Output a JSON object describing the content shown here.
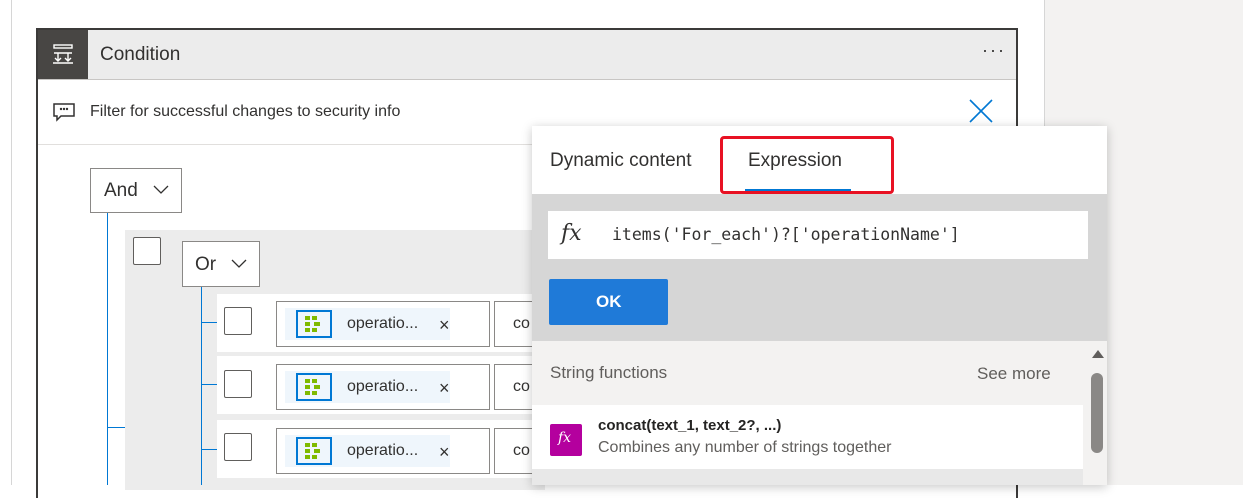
{
  "condition": {
    "title": "Condition",
    "more_label": "···",
    "comment": "Filter for successful changes to security info"
  },
  "builder": {
    "and_label": "And",
    "or_label": "Or",
    "rows": [
      {
        "token_label": "operatio...",
        "remove_label": "×",
        "operator_partial": "co"
      },
      {
        "token_label": "operatio...",
        "remove_label": "×",
        "operator_partial": "co"
      },
      {
        "token_label": "operatio...",
        "remove_label": "×",
        "operator_partial": "co"
      }
    ]
  },
  "popup": {
    "tabs": [
      {
        "label": "Dynamic content",
        "active": false
      },
      {
        "label": "Expression",
        "active": true
      }
    ],
    "expression_icon": "fx",
    "expression_value": "items('For_each')?['operationName']",
    "ok_label": "OK",
    "functions": {
      "section_title": "String functions",
      "see_more_label": "See more",
      "items": [
        {
          "icon": "fx",
          "name": "concat(text_1, text_2?, ...)",
          "description": "Combines any number of strings together"
        }
      ]
    }
  },
  "colors": {
    "accent": "#0078d4",
    "ok_button": "#1f7ad8",
    "highlight": "#e81123",
    "function_icon": "#b4009e"
  }
}
